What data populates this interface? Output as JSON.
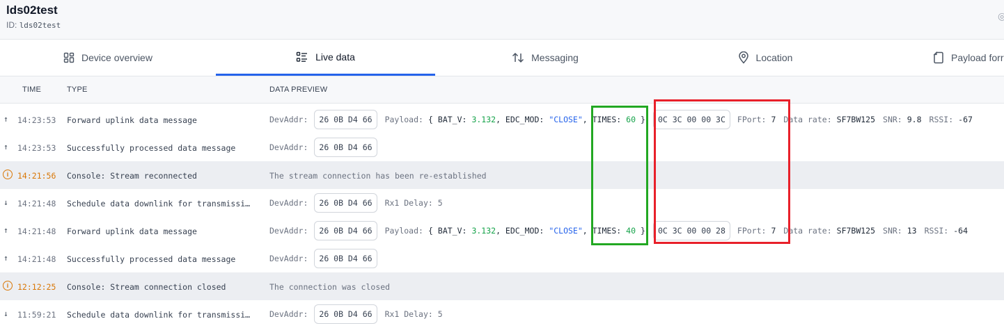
{
  "header": {
    "title": "lds02test",
    "id_label": "ID:",
    "id_value": "lds02test"
  },
  "tabs": [
    {
      "label": "Device overview",
      "icon": "grid-icon"
    },
    {
      "label": "Live data",
      "icon": "list-icon",
      "active": true
    },
    {
      "label": "Messaging",
      "icon": "arrows-updown-icon"
    },
    {
      "label": "Location",
      "icon": "location-pin-icon"
    },
    {
      "label": "Payload forr",
      "icon": "document-icon"
    }
  ],
  "columns": {
    "time": "TIME",
    "type": "TYPE",
    "preview": "DATA PREVIEW"
  },
  "rows": [
    {
      "kind": "up",
      "time": "14:23:53",
      "type": "Forward uplink data message",
      "devaddr_label": "DevAddr:",
      "devaddr": "26 0B D4 66",
      "payload_label": "Payload:",
      "p_open": "{",
      "bat_key": "BAT_V:",
      "bat_val": "3.132",
      "edc_key": ", EDC_MOD:",
      "edc_val": "\"CLOSE\"",
      "times_key": ", TIMES:",
      "times_val": "60",
      "p_close": "}",
      "raw": "0C 3C 00 00 3C",
      "fport_label": "FPort:",
      "fport": "7",
      "rate_label": "Data rate:",
      "rate": "SF7BW125",
      "snr_label": "SNR:",
      "snr": "9.8",
      "rssi_label": "RSSI:",
      "rssi": "-67"
    },
    {
      "kind": "up",
      "time": "14:23:53",
      "type": "Successfully processed data message",
      "devaddr_label": "DevAddr:",
      "devaddr": "26 0B D4 66"
    },
    {
      "kind": "warn",
      "time": "14:21:56",
      "type": "Console: Stream reconnected",
      "text": "The stream connection has been re-established"
    },
    {
      "kind": "down",
      "time": "14:21:48",
      "type": "Schedule data downlink for transmissi…",
      "devaddr_label": "DevAddr:",
      "devaddr": "26 0B D4 66",
      "extra": "Rx1 Delay: 5"
    },
    {
      "kind": "up",
      "time": "14:21:48",
      "type": "Forward uplink data message",
      "devaddr_label": "DevAddr:",
      "devaddr": "26 0B D4 66",
      "payload_label": "Payload:",
      "p_open": "{",
      "bat_key": "BAT_V:",
      "bat_val": "3.132",
      "edc_key": ", EDC_MOD:",
      "edc_val": "\"CLOSE\"",
      "times_key": ", TIMES:",
      "times_val": "40",
      "p_close": "}",
      "raw": "0C 3C 00 00 28",
      "fport_label": "FPort:",
      "fport": "7",
      "rate_label": "Data rate:",
      "rate": "SF7BW125",
      "snr_label": "SNR:",
      "snr": "13",
      "rssi_label": "RSSI:",
      "rssi": "-64"
    },
    {
      "kind": "up",
      "time": "14:21:48",
      "type": "Successfully processed data message",
      "devaddr_label": "DevAddr:",
      "devaddr": "26 0B D4 66"
    },
    {
      "kind": "warn",
      "time": "12:12:25",
      "type": "Console: Stream connection closed",
      "text": "The connection was closed"
    },
    {
      "kind": "down",
      "time": "11:59:21",
      "type": "Schedule data downlink for transmissi…",
      "devaddr_label": "DevAddr:",
      "devaddr": "26 0B D4 66",
      "extra": "Rx1 Delay: 5"
    }
  ],
  "annotation_colors": {
    "green": "#22a822",
    "red": "#e8202a"
  }
}
